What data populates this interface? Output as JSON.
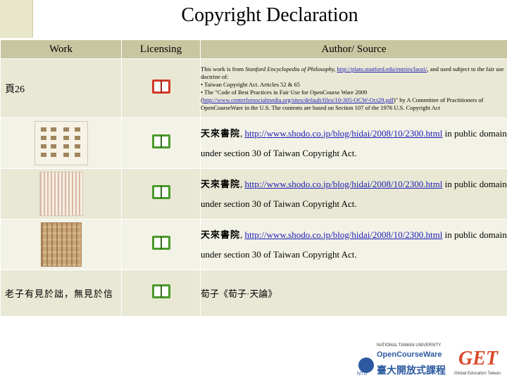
{
  "title": "Copyright Declaration",
  "headers": {
    "work": "Work",
    "licensing": "Licensing",
    "source": "Author/ Source"
  },
  "rows": [
    {
      "work": "頁26",
      "license_icon": "red-book-icon",
      "src": {
        "pre": "This work is from ",
        "italic": "Stanford Encyclopedia of Philosophy,",
        "link": "http://plato.stanford.edu/entries/laozi/",
        "l1": ", and used subject to the fair use doctrine of:",
        "l2": "• Taiwan Copyright Act. Articles 52 & 65",
        "l3": "• The \"Code of Best Practices in Fair Use for OpenCourse Ware 2009",
        "link2": "http://www.centerforsocialmedia.org/sites/default/files/10-305-OCW-Oct29.pdf",
        "l4": ")\" by A Committee of Practitioners of OpenCourseWare in the U.S. The contents are based on Section 107 of the 1976 U.S. Copyright Act"
      }
    },
    {
      "work": "",
      "license_icon": "green-book-icon",
      "src": {
        "name": "天來書院",
        "sep": ",",
        "link": "http://www.shodo.co.jp/blog/hidai/2008/10/2300.html",
        "rest": "in public domain under section 30 of Taiwan Copyright Act."
      }
    },
    {
      "work": "",
      "license_icon": "green-book-icon",
      "src": {
        "name": "天來書院",
        "sep": ",",
        "link": "http://www.shodo.co.jp/blog/hidai/2008/10/2300.html",
        "rest": "in public domain under section 30 of Taiwan Copyright Act."
      }
    },
    {
      "work": "",
      "license_icon": "green-book-icon",
      "src": {
        "name": "天來書院",
        "sep": ",",
        "link": "http://www.shodo.co.jp/blog/hidai/2008/10/2300.html",
        "rest": "in public domain under section 30 of Taiwan Copyright Act."
      }
    },
    {
      "work": "老子有見於詘，無見於信",
      "license_icon": "green-book-icon",
      "src": {
        "text": "荀子《荀子·天論》"
      }
    }
  ],
  "footer": {
    "ntu_sub": "NTU",
    "ocw_line1": "NATIONAL TAIWAN UNIVERSITY",
    "ocw_line2": "OpenCourseWare",
    "ocw_line3": "臺大開放式課程",
    "get_logo": "GET",
    "get_sub": "Global Education Taiwan"
  },
  "colors": {
    "header": "#c8c6a0",
    "row_a": "#e9e8d4",
    "row_b": "#f3f2e7",
    "accent": "#e9e7c9",
    "red_icon": "#d23a2a",
    "green_icon": "#4a9a2a",
    "link": "#1b1bb5"
  }
}
